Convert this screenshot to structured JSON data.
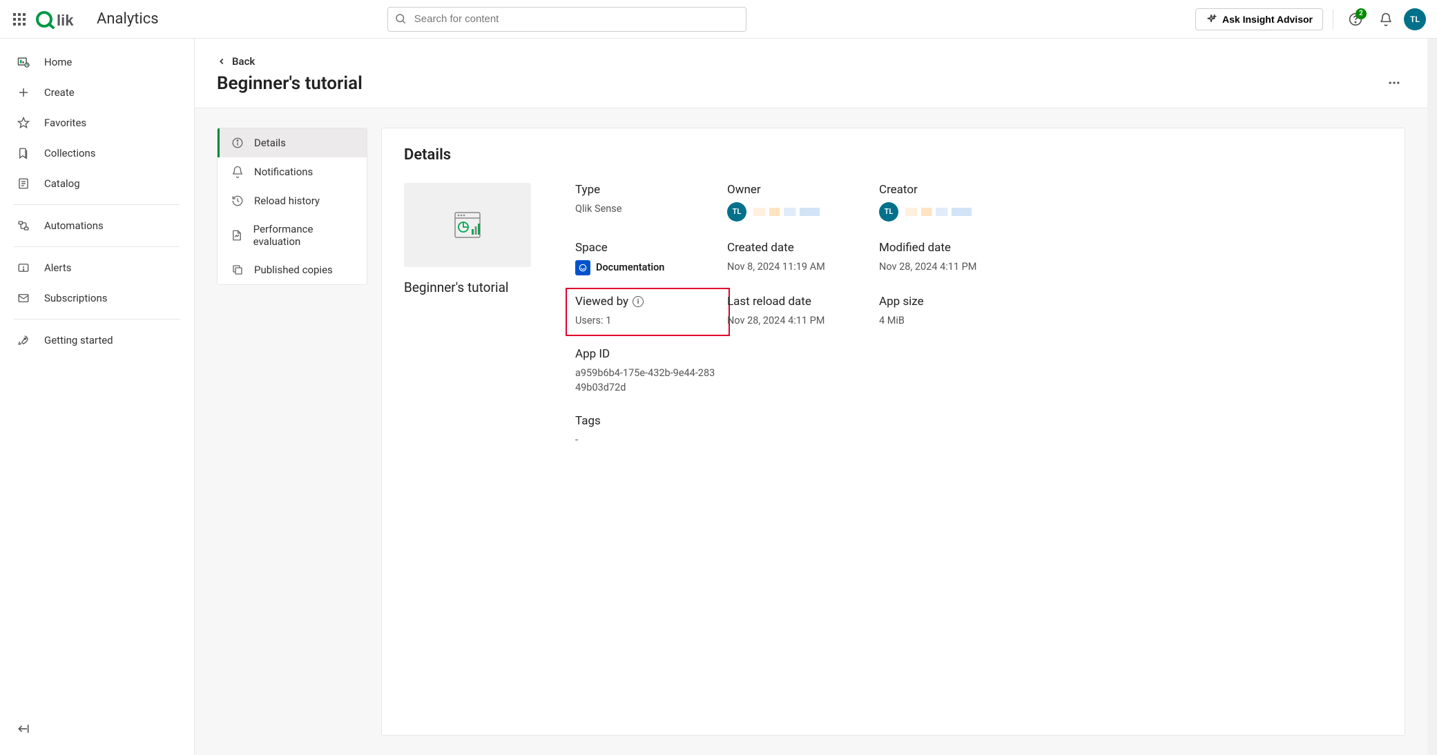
{
  "top": {
    "app_name": "Analytics",
    "search_placeholder": "Search for content",
    "insight_label": "Ask Insight Advisor",
    "notif_count": "2",
    "avatar_initials": "TL"
  },
  "sidebar": {
    "items": [
      {
        "label": "Home"
      },
      {
        "label": "Create"
      },
      {
        "label": "Favorites"
      },
      {
        "label": "Collections"
      },
      {
        "label": "Catalog"
      },
      {
        "label": "Automations"
      },
      {
        "label": "Alerts"
      },
      {
        "label": "Subscriptions"
      },
      {
        "label": "Getting started"
      }
    ]
  },
  "page": {
    "back_label": "Back",
    "title": "Beginner's tutorial",
    "tabs": [
      {
        "label": "Details"
      },
      {
        "label": "Notifications"
      },
      {
        "label": "Reload history"
      },
      {
        "label": "Performance evaluation"
      },
      {
        "label": "Published copies"
      }
    ]
  },
  "details": {
    "panel_title": "Details",
    "thumb_title": "Beginner's tutorial",
    "type_label": "Type",
    "type_value": "Qlik Sense",
    "owner_label": "Owner",
    "owner_initials": "TL",
    "creator_label": "Creator",
    "creator_initials": "TL",
    "space_label": "Space",
    "space_value": "Documentation",
    "created_label": "Created date",
    "created_value": "Nov 8, 2024 11:19 AM",
    "modified_label": "Modified date",
    "modified_value": "Nov 28, 2024 4:11 PM",
    "viewed_label": "Viewed by",
    "viewed_value": "Users: 1",
    "reload_label": "Last reload date",
    "reload_value": "Nov 28, 2024 4:11 PM",
    "size_label": "App size",
    "size_value": "4 MiB",
    "appid_label": "App ID",
    "appid_value": "a959b6b4-175e-432b-9e44-28349b03d72d",
    "tags_label": "Tags",
    "tags_value": "-"
  }
}
